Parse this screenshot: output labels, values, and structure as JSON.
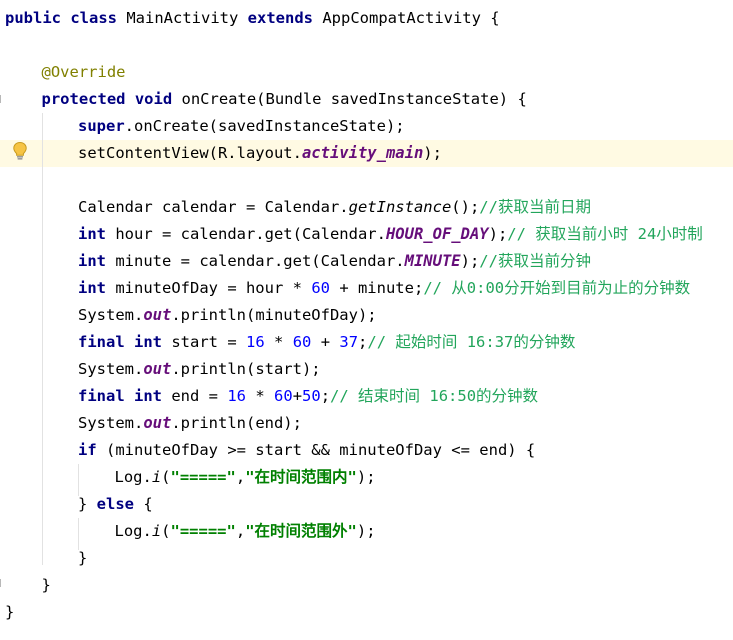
{
  "editor": {
    "language": "java",
    "highlighted_line": 6,
    "intention_icon": "lightbulb-icon",
    "colors": {
      "keyword": "#000080",
      "annotation": "#808000",
      "comment": "#22a55b",
      "number": "#0000ff",
      "string": "#008000",
      "field": "#660e7a",
      "highlight_bg": "#fffae3"
    },
    "lines": [
      {
        "n": 1,
        "indent": 0,
        "tokens": [
          {
            "t": "public",
            "c": "kw"
          },
          {
            "t": " "
          },
          {
            "t": "class",
            "c": "kw"
          },
          {
            "t": " MainActivity "
          },
          {
            "t": "extends",
            "c": "kw"
          },
          {
            "t": " AppCompatActivity {"
          }
        ]
      },
      {
        "n": 2,
        "indent": 0,
        "tokens": []
      },
      {
        "n": 3,
        "indent": 1,
        "tokens": [
          {
            "t": "@Override",
            "c": "ann"
          }
        ]
      },
      {
        "n": 4,
        "indent": 1,
        "tokens": [
          {
            "t": "protected",
            "c": "kw"
          },
          {
            "t": " "
          },
          {
            "t": "void",
            "c": "kw"
          },
          {
            "t": " onCreate(Bundle savedInstanceState) {"
          }
        ]
      },
      {
        "n": 5,
        "indent": 2,
        "tokens": [
          {
            "t": "super",
            "c": "kw"
          },
          {
            "t": ".onCreate(savedInstanceState);"
          }
        ]
      },
      {
        "n": 6,
        "indent": 2,
        "tokens": [
          {
            "t": "setContentView(R.layout."
          },
          {
            "t": "activity_main",
            "c": "fld"
          },
          {
            "t": ");"
          }
        ]
      },
      {
        "n": 7,
        "indent": 0,
        "tokens": []
      },
      {
        "n": 8,
        "indent": 2,
        "tokens": [
          {
            "t": "Calendar calendar = Calendar."
          },
          {
            "t": "getInstance",
            "c": "sm"
          },
          {
            "t": "();"
          },
          {
            "t": "//获取当前日期",
            "c": "cmt"
          }
        ]
      },
      {
        "n": 9,
        "indent": 2,
        "tokens": [
          {
            "t": "int",
            "c": "kw"
          },
          {
            "t": " hour = calendar.get(Calendar."
          },
          {
            "t": "HOUR_OF_DAY",
            "c": "fld"
          },
          {
            "t": ");"
          },
          {
            "t": "// 获取当前小时 24小时制",
            "c": "cmt"
          }
        ]
      },
      {
        "n": 10,
        "indent": 2,
        "tokens": [
          {
            "t": "int",
            "c": "kw"
          },
          {
            "t": " minute = calendar.get(Calendar."
          },
          {
            "t": "MINUTE",
            "c": "fld"
          },
          {
            "t": ");"
          },
          {
            "t": "//获取当前分钟",
            "c": "cmt"
          }
        ]
      },
      {
        "n": 11,
        "indent": 2,
        "tokens": [
          {
            "t": "int",
            "c": "kw"
          },
          {
            "t": " minuteOfDay = hour * "
          },
          {
            "t": "60",
            "c": "num"
          },
          {
            "t": " + minute;"
          },
          {
            "t": "// 从0:00分开始到目前为止的分钟数",
            "c": "cmt"
          }
        ]
      },
      {
        "n": 12,
        "indent": 2,
        "tokens": [
          {
            "t": "System."
          },
          {
            "t": "out",
            "c": "fld"
          },
          {
            "t": ".println(minuteOfDay);"
          }
        ]
      },
      {
        "n": 13,
        "indent": 2,
        "tokens": [
          {
            "t": "final",
            "c": "kw"
          },
          {
            "t": " "
          },
          {
            "t": "int",
            "c": "kw"
          },
          {
            "t": " start = "
          },
          {
            "t": "16",
            "c": "num"
          },
          {
            "t": " * "
          },
          {
            "t": "60",
            "c": "num"
          },
          {
            "t": " + "
          },
          {
            "t": "37",
            "c": "num"
          },
          {
            "t": ";"
          },
          {
            "t": "// 起始时间 16:37的分钟数",
            "c": "cmt"
          }
        ]
      },
      {
        "n": 14,
        "indent": 2,
        "tokens": [
          {
            "t": "System."
          },
          {
            "t": "out",
            "c": "fld"
          },
          {
            "t": ".println(start);"
          }
        ]
      },
      {
        "n": 15,
        "indent": 2,
        "tokens": [
          {
            "t": "final",
            "c": "kw"
          },
          {
            "t": " "
          },
          {
            "t": "int",
            "c": "kw"
          },
          {
            "t": " end = "
          },
          {
            "t": "16",
            "c": "num"
          },
          {
            "t": " * "
          },
          {
            "t": "60",
            "c": "num"
          },
          {
            "t": "+"
          },
          {
            "t": "50",
            "c": "num"
          },
          {
            "t": ";"
          },
          {
            "t": "// 结束时间 16:50的分钟数",
            "c": "cmt"
          }
        ]
      },
      {
        "n": 16,
        "indent": 2,
        "tokens": [
          {
            "t": "System."
          },
          {
            "t": "out",
            "c": "fld"
          },
          {
            "t": ".println(end);"
          }
        ]
      },
      {
        "n": 17,
        "indent": 2,
        "tokens": [
          {
            "t": "if",
            "c": "kw"
          },
          {
            "t": " (minuteOfDay >= start && minuteOfDay <= end) {"
          }
        ]
      },
      {
        "n": 18,
        "indent": 3,
        "tokens": [
          {
            "t": "Log."
          },
          {
            "t": "i",
            "c": "sm"
          },
          {
            "t": "("
          },
          {
            "t": "\"=====\"",
            "c": "str"
          },
          {
            "t": ","
          },
          {
            "t": "\"在时间范围内\"",
            "c": "str"
          },
          {
            "t": ");"
          }
        ]
      },
      {
        "n": 19,
        "indent": 2,
        "tokens": [
          {
            "t": "} "
          },
          {
            "t": "else",
            "c": "kw"
          },
          {
            "t": " {"
          }
        ]
      },
      {
        "n": 20,
        "indent": 3,
        "tokens": [
          {
            "t": "Log."
          },
          {
            "t": "i",
            "c": "sm"
          },
          {
            "t": "("
          },
          {
            "t": "\"=====\"",
            "c": "str"
          },
          {
            "t": ","
          },
          {
            "t": "\"在时间范围外\"",
            "c": "str"
          },
          {
            "t": ");"
          }
        ]
      },
      {
        "n": 21,
        "indent": 2,
        "tokens": [
          {
            "t": "}"
          }
        ]
      },
      {
        "n": 22,
        "indent": 1,
        "tokens": [
          {
            "t": "}"
          }
        ]
      },
      {
        "n": 23,
        "indent": 0,
        "tokens": [
          {
            "t": "}"
          }
        ]
      }
    ]
  }
}
